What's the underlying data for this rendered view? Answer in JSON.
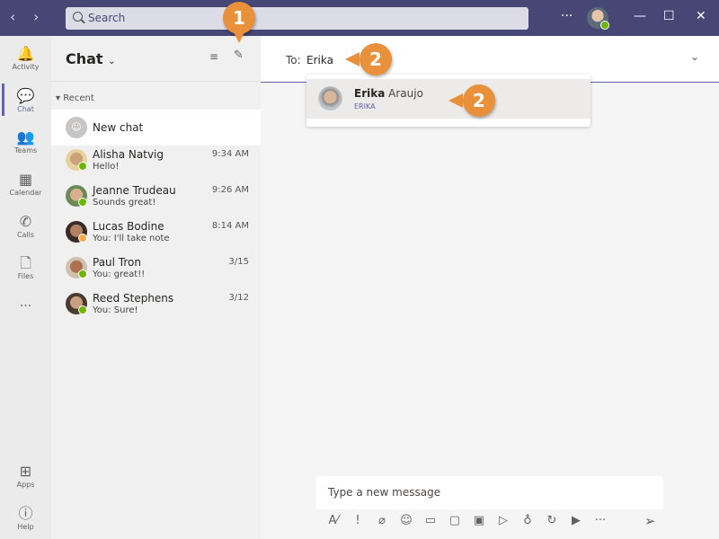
{
  "titlebar": {
    "search_placeholder": "Search",
    "more": "···",
    "minimize": "—",
    "maximize": "☐",
    "close": "✕",
    "back": "‹",
    "forward": "›"
  },
  "rail": {
    "items": [
      {
        "label": "Activity",
        "icon": "bell-icon",
        "glyph": "🔔"
      },
      {
        "label": "Chat",
        "icon": "chat-icon",
        "glyph": "💬"
      },
      {
        "label": "Teams",
        "icon": "teams-icon",
        "glyph": "👥"
      },
      {
        "label": "Calendar",
        "icon": "calendar-icon",
        "glyph": "▦"
      },
      {
        "label": "Calls",
        "icon": "phone-icon",
        "glyph": "✆"
      },
      {
        "label": "Files",
        "icon": "file-icon",
        "glyph": "🗋"
      }
    ],
    "more": "···",
    "apps": "Apps",
    "help": "Help"
  },
  "list": {
    "title": "Chat",
    "section": "Recent",
    "new_chat": "New chat",
    "chats": [
      {
        "name": "Alisha Natvig",
        "preview": "Hello!",
        "time": "9:34 AM",
        "status": "available"
      },
      {
        "name": "Jeanne Trudeau",
        "preview": "Sounds great!",
        "time": "9:26 AM",
        "status": "available"
      },
      {
        "name": "Lucas Bodine",
        "preview": "You: I'll take note",
        "time": "8:14 AM",
        "status": "away"
      },
      {
        "name": "Paul Tron",
        "preview": "You: great!!",
        "time": "3/15",
        "status": "available"
      },
      {
        "name": "Reed Stephens",
        "preview": "You: Sure!",
        "time": "3/12",
        "status": "available"
      }
    ]
  },
  "main": {
    "to_label": "To:",
    "to_value": "Erika",
    "suggestion": {
      "first": "Erika",
      "last": " Araujo",
      "sub": "ERIKA"
    },
    "compose_placeholder": "Type a new message"
  },
  "callouts": [
    "1",
    "2",
    "2"
  ],
  "colors": {
    "titlebar": "#464775",
    "accent": "#6264a7",
    "callout": "#e8913a",
    "available": "#6bb700",
    "away": "#ffaa44"
  }
}
